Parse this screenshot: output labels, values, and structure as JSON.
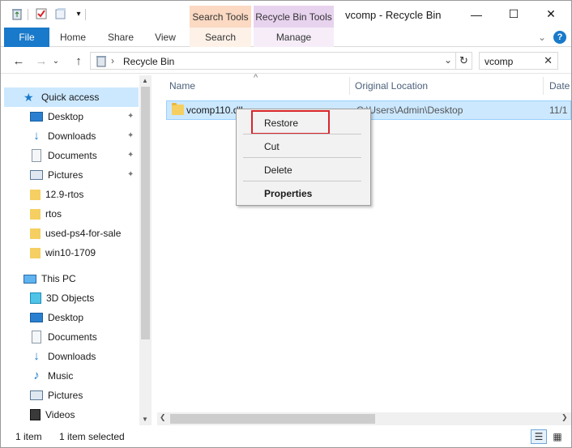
{
  "window": {
    "title": "vcomp - Recycle Bin",
    "minimize_glyph": "—",
    "maximize_glyph": "☐",
    "close_glyph": "✕"
  },
  "context_tabs": {
    "search_tools": "Search Tools",
    "recycle_bin_tools": "Recycle Bin Tools"
  },
  "ribbon": {
    "tabs": [
      "File",
      "Home",
      "Share",
      "View",
      "Search",
      "Manage"
    ],
    "expand_glyph": "⌄",
    "help_glyph": "?"
  },
  "address": {
    "back": "←",
    "forward": "→",
    "history": "⌄",
    "up": "↑",
    "separator": "›",
    "path": "Recycle Bin",
    "dropdown": "⌄",
    "refresh": "↻"
  },
  "search": {
    "value": "vcomp",
    "clear": "✕"
  },
  "nav": {
    "quick_access": "Quick access",
    "quick_items": [
      {
        "label": "Desktop",
        "pinned": true
      },
      {
        "label": "Downloads",
        "pinned": true
      },
      {
        "label": "Documents",
        "pinned": true
      },
      {
        "label": "Pictures",
        "pinned": true
      },
      {
        "label": "12.9-rtos",
        "pinned": false
      },
      {
        "label": "rtos",
        "pinned": false
      },
      {
        "label": "used-ps4-for-sale",
        "pinned": false
      },
      {
        "label": "win10-1709",
        "pinned": false
      }
    ],
    "this_pc": "This PC",
    "pc_items": [
      "3D Objects",
      "Desktop",
      "Documents",
      "Downloads",
      "Music",
      "Pictures",
      "Videos"
    ],
    "pin_glyph": "📌"
  },
  "content": {
    "columns": [
      "Name",
      "Original Location",
      "Date"
    ],
    "sort_glyph": "^",
    "rows": [
      {
        "name": "vcomp110.dll",
        "location": "C:\\Users\\Admin\\Desktop",
        "date": "11/1"
      }
    ]
  },
  "context_menu": {
    "items": [
      "Restore",
      "Cut",
      "Delete",
      "Properties"
    ]
  },
  "status": {
    "item_count": "1 item",
    "selected": "1 item selected"
  },
  "scroll": {
    "up": "▲",
    "down": "▼",
    "left": "❮",
    "right": "❯"
  }
}
